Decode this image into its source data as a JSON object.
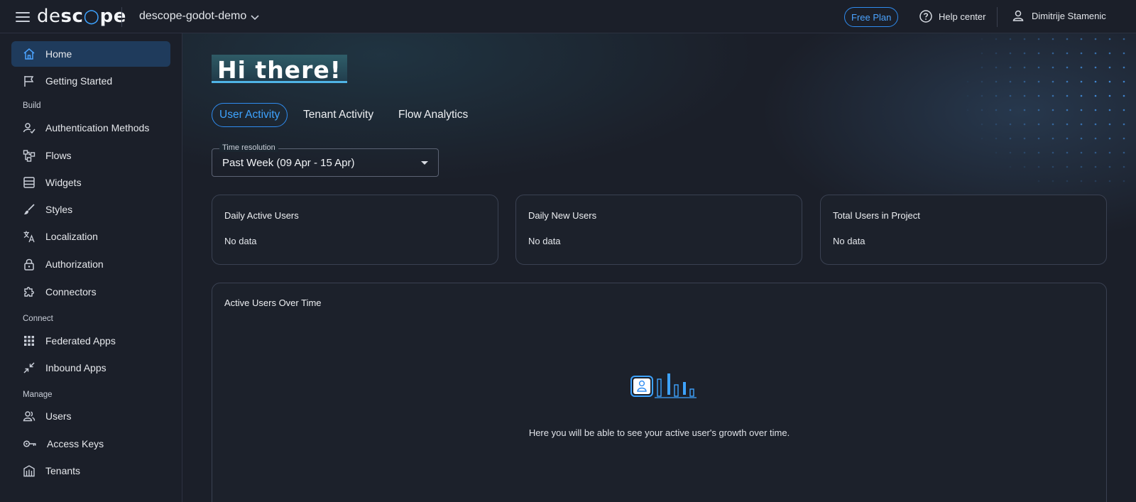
{
  "topbar": {
    "logo_text": "descope",
    "project": "descope-godot-demo",
    "plan": "Free Plan",
    "help": "Help center",
    "user": "Dimitrije Stamenic"
  },
  "sidebar": {
    "home": "Home",
    "getting_started": "Getting Started",
    "section_build": "Build",
    "auth_methods": "Authentication Methods",
    "flows": "Flows",
    "widgets": "Widgets",
    "styles": "Styles",
    "localization": "Localization",
    "authorization": "Authorization",
    "connectors": "Connectors",
    "section_connect": "Connect",
    "federated_apps": "Federated Apps",
    "inbound_apps": "Inbound Apps",
    "section_manage": "Manage",
    "users": "Users",
    "access_keys": "Access Keys",
    "tenants": "Tenants"
  },
  "main": {
    "greeting": "Hi there!",
    "tabs": [
      "User Activity",
      "Tenant Activity",
      "Flow Analytics"
    ],
    "time_resolution_label": "Time resolution",
    "time_resolution_value": "Past Week (09 Apr - 15 Apr)",
    "cards": [
      {
        "title": "Daily Active Users",
        "value": "No data"
      },
      {
        "title": "Daily New Users",
        "value": "No data"
      },
      {
        "title": "Total Users in Project",
        "value": "No data"
      }
    ],
    "chart_title": "Active Users Over Time",
    "chart_empty_text": "Here you will be able to see your active user's growth over time."
  },
  "colors": {
    "accent": "#3ea3ff",
    "active_nav_bg": "#1f3b5c",
    "background": "#1b1f29"
  }
}
